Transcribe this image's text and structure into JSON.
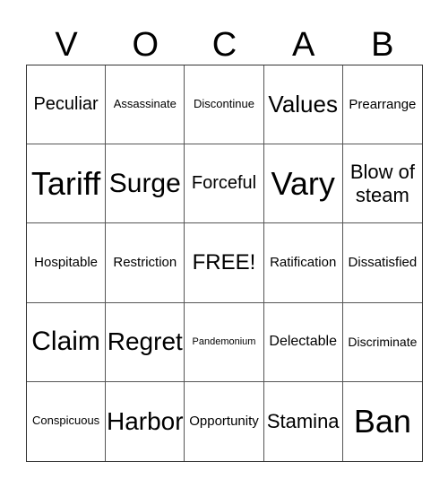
{
  "header": [
    "V",
    "O",
    "C",
    "A",
    "B"
  ],
  "cells": [
    [
      "Peculiar",
      "Assassinate",
      "Discontinue",
      "Values",
      "Prearrange"
    ],
    [
      "Tariff",
      "Surge",
      "Forceful",
      "Vary",
      "Blow of steam"
    ],
    [
      "Hospitable",
      "Restriction",
      "FREE!",
      "Ratification",
      "Dissatisfied"
    ],
    [
      "Claim",
      "Regret",
      "Pandemonium",
      "Delectable",
      "Discriminate"
    ],
    [
      "Conspicuous",
      "Harbor",
      "Opportunity",
      "Stamina",
      "Ban"
    ]
  ]
}
